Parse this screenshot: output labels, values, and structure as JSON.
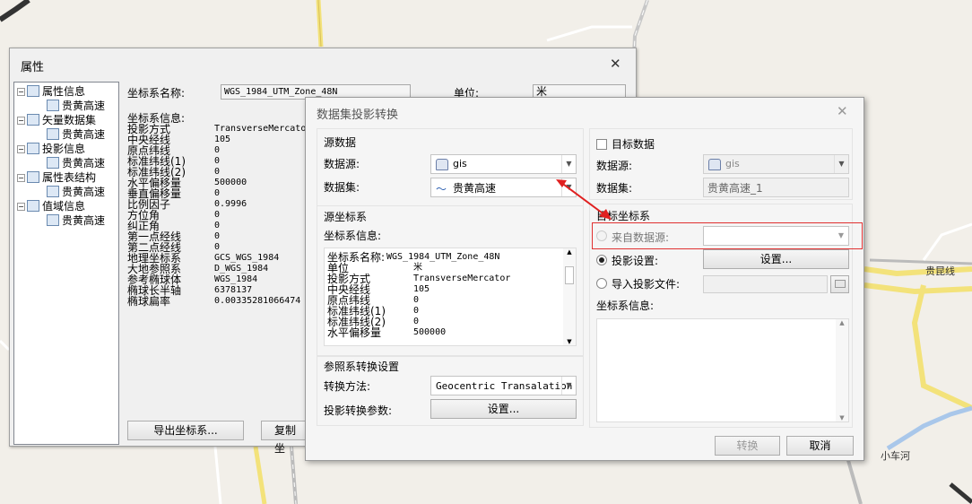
{
  "map": {
    "labels": [
      "贵昆线",
      "小车河"
    ]
  },
  "properties_window": {
    "title": "属性",
    "tree": [
      {
        "label": "属性信息",
        "child": "贵黄高速"
      },
      {
        "label": "矢量数据集",
        "child": "贵黄高速"
      },
      {
        "label": "投影信息",
        "child": "贵黄高速"
      },
      {
        "label": "属性表结构",
        "child": "贵黄高速"
      },
      {
        "label": "值域信息",
        "child": "贵黄高速"
      }
    ],
    "crs_name_label": "坐标系名称:",
    "crs_name_value": "WGS_1984_UTM_Zone_48N",
    "unit_label": "单位:",
    "unit_value": "米",
    "crs_info_label": "坐标系信息:",
    "info_rows": [
      {
        "k": "投影方式",
        "v": "TransverseMercato"
      },
      {
        "k": "中央经线",
        "v": "105"
      },
      {
        "k": "原点纬线",
        "v": "0"
      },
      {
        "k": "标准纬线(1)",
        "v": "0"
      },
      {
        "k": "标准纬线(2)",
        "v": "0"
      },
      {
        "k": "水平偏移量",
        "v": "500000"
      },
      {
        "k": "垂直偏移量",
        "v": "0"
      },
      {
        "k": "比例因子",
        "v": "0.9996"
      },
      {
        "k": "方位角",
        "v": "0"
      },
      {
        "k": "纠正角",
        "v": "0"
      },
      {
        "k": "第一点经线",
        "v": "0"
      },
      {
        "k": "第二点经线",
        "v": "0"
      },
      {
        "k": "地理坐标系",
        "v": "GCS_WGS_1984"
      },
      {
        "k": "大地参照系",
        "v": "D_WGS_1984"
      },
      {
        "k": "参考椭球体",
        "v": "WGS_1984"
      },
      {
        "k": "椭球长半轴",
        "v": "6378137"
      },
      {
        "k": "椭球扁率",
        "v": "0.00335281066474"
      }
    ],
    "export_button": "导出坐标系...",
    "copy_button": "复制坐"
  },
  "dialog": {
    "title": "数据集投影转换",
    "source_data": {
      "title": "源数据",
      "datasource_label": "数据源:",
      "datasource_value": "gis",
      "dataset_label": "数据集:",
      "dataset_value": "贵黄高速"
    },
    "source_crs": {
      "title": "源坐标系",
      "info_label": "坐标系信息:",
      "rows": [
        {
          "k": "坐标系名称:",
          "v": "WGS_1984_UTM_Zone_48N"
        },
        {
          "k": "单位",
          "v": "米"
        },
        {
          "k": "投影方式",
          "v": "TransverseMercator"
        },
        {
          "k": "中央经线",
          "v": "105"
        },
        {
          "k": "原点纬线",
          "v": "0"
        },
        {
          "k": "标准纬线(1)",
          "v": "0"
        },
        {
          "k": "标准纬线(2)",
          "v": "0"
        },
        {
          "k": "水平偏移量",
          "v": "500000"
        }
      ]
    },
    "ref_transform": {
      "title": "参照系转换设置",
      "method_label": "转换方法:",
      "method_value": "Geocentric Transalation",
      "params_label": "投影转换参数:",
      "params_button": "设置..."
    },
    "target_data": {
      "checkbox_label": "目标数据",
      "datasource_label": "数据源:",
      "datasource_value": "gis",
      "dataset_label": "数据集:",
      "dataset_value": "贵黄高速_1"
    },
    "target_crs": {
      "title": "目标坐标系",
      "from_datasource_label": "来自数据源:",
      "from_datasource_value": "",
      "projection_settings_label": "投影设置:",
      "projection_settings_button": "设置...",
      "import_file_label": "导入投影文件:",
      "info_label": "坐标系信息:"
    },
    "convert_button": "转换",
    "cancel_button": "取消"
  }
}
